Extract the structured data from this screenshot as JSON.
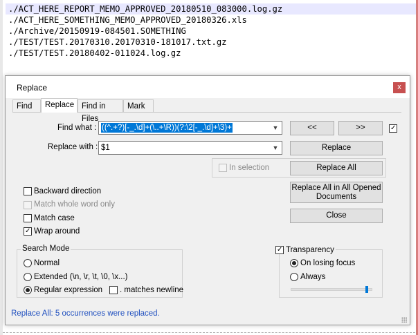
{
  "editor": {
    "lines": [
      "./ACT_HERE_REPORT_MEMO_APPROVED_20180510_083000.log.gz",
      "./ACT_HERE_SOMETHING_MEMO_APPROVED_20180326.xls",
      "./Archive/20150919-084501.SOMETHING",
      "./TEST/TEST.20170310.20170310-181017.txt.gz",
      "./TEST/TEST.20180402-011024.log.gz"
    ]
  },
  "dialog": {
    "title": "Replace",
    "close_label": "x",
    "tabs": [
      "Find",
      "Replace",
      "Find in Files",
      "Mark"
    ],
    "find_label": "Find what :",
    "find_value": "((^.+?)[-_.\\d]+(\\..+\\R))(?:\\2[-_.\\d]+\\3)+",
    "replace_label": "Replace with :",
    "replace_value": "$1",
    "buttons": {
      "prev": "<<",
      "next": ">>",
      "replace": "Replace",
      "replace_all": "Replace All",
      "replace_all_opened": "Replace All in All Opened Documents",
      "close": "Close"
    },
    "in_selection": "In selection",
    "options": {
      "backward": "Backward direction",
      "whole_word": "Match whole word only",
      "match_case": "Match case",
      "wrap_around": "Wrap around"
    },
    "search_mode": {
      "title": "Search Mode",
      "normal": "Normal",
      "extended": "Extended (\\n, \\r, \\t, \\0, \\x...)",
      "regex": "Regular expression",
      "newline": ". matches newline",
      "selected": "regex"
    },
    "transparency": {
      "title": "Transparency",
      "on_losing_focus": "On losing focus",
      "always": "Always",
      "selected": "on_losing_focus",
      "level": 0.95
    },
    "status": "Replace All: 5 occurrences were replaced."
  }
}
